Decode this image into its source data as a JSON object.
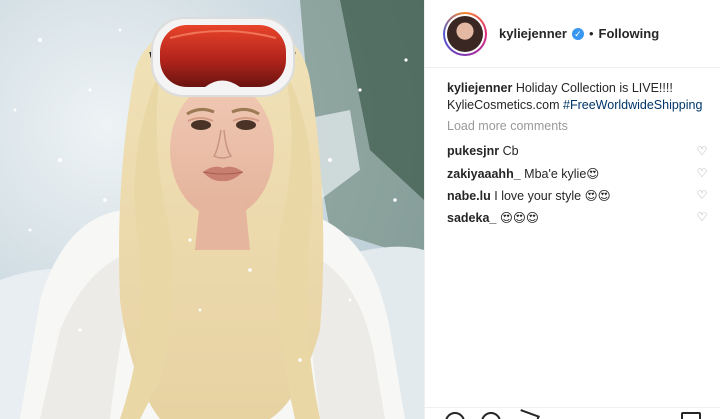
{
  "post": {
    "image_alt": "Kylie Jenner wearing ski goggles and white fur in snowy scene"
  },
  "header": {
    "username": "kyliejenner",
    "verified_mark": "✓",
    "separator": "•",
    "follow_status": "Following",
    "avatar_icon": "avatar-icon"
  },
  "caption": {
    "username": "kyliejenner",
    "text": "Holiday Collection is LIVE!!!!",
    "link": "KylieCosmetics.com",
    "hashtag": "#FreeWorldwideShipping"
  },
  "load_more": "Load more comments",
  "comments": [
    {
      "user": "pukesjnr",
      "text": "Cb"
    },
    {
      "user": "zakiyaaahh_",
      "text": "Mba'e kylie😍"
    },
    {
      "user": "nabe.lu",
      "text": "I love your style 😍😍"
    },
    {
      "user": "sadeka_",
      "text": "😍😍😍"
    }
  ],
  "icons": {
    "heart": "♡",
    "like": "heart-icon",
    "comment": "comment-icon",
    "share": "share-icon",
    "save": "bookmark-icon"
  },
  "colors": {
    "verified": "#3897f0",
    "hashtag": "#003569",
    "muted": "#999999",
    "text": "#262626"
  }
}
